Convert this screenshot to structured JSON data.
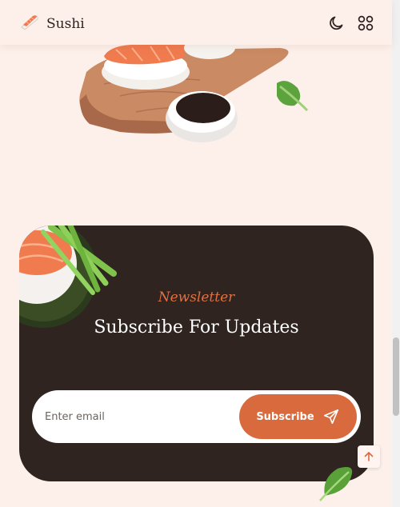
{
  "header": {
    "brand": "Sushi",
    "icons": {
      "logo": "sushi-logo-icon",
      "theme": "moon-icon",
      "menu": "grid-icon"
    }
  },
  "newsletter": {
    "subtitle": "Newsletter",
    "title": "Subscribe For Updates",
    "email_placeholder": "Enter email",
    "subscribe_label": "Subscribe",
    "send_icon": "send-icon"
  },
  "back_to_top_icon": "arrow-up-icon",
  "colors": {
    "background": "#fdf0ea",
    "card": "#2f2420",
    "accent": "#d86a3d",
    "text_dark": "#2d2220"
  }
}
